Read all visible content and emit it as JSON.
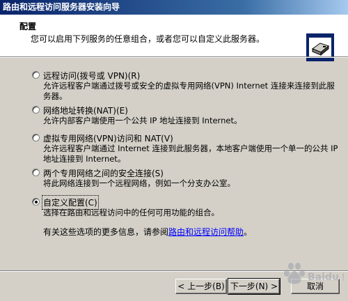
{
  "window": {
    "title": "路由和远程访问服务器安装向导"
  },
  "header": {
    "title": "配置",
    "subtitle": "您可以启用下列服务的任意组合，或者您可以自定义此服务器。"
  },
  "options": [
    {
      "label": "远程访问(拨号或 VPN)(R)",
      "description": "允许远程客户端通过拨号或安全的虚拟专用网络(VPN) Internet 连接来连接到此服务器。",
      "checked": false
    },
    {
      "label": "网络地址转换(NAT)(E)",
      "description": "允许内部客户端使用一个公共 IP 地址连接到 Internet。",
      "checked": false
    },
    {
      "label": "虚拟专用网络(VPN)访问和 NAT(V)",
      "description": "允许远程客户端通过 Internet 连接到此服务器，本地客户端使用一个单一的公共 IP 地址连接到 Internet。",
      "checked": false
    },
    {
      "label": "两个专用网络之间的安全连接(S)",
      "description": "将此网络连接到一个远程网络，例如一个分支办公室。",
      "checked": false
    },
    {
      "label": "自定义配置(C)",
      "description": "选择在路由和远程访问中的任何可用功能的组合。",
      "checked": true
    }
  ],
  "help": {
    "prefix": "有关这些选项的更多信息，请参阅",
    "link": "路由和远程访问帮助",
    "suffix": "。"
  },
  "buttons": {
    "back": "< 上一步(B)",
    "next": "下一步(N) >",
    "cancel": "取消"
  },
  "watermark_text": "Baidu 经验",
  "colors": {
    "titlebar_start": "#0a246a",
    "titlebar_end": "#a6caf0",
    "dialog_bg": "#d4d0c8",
    "link": "#0000ff"
  }
}
